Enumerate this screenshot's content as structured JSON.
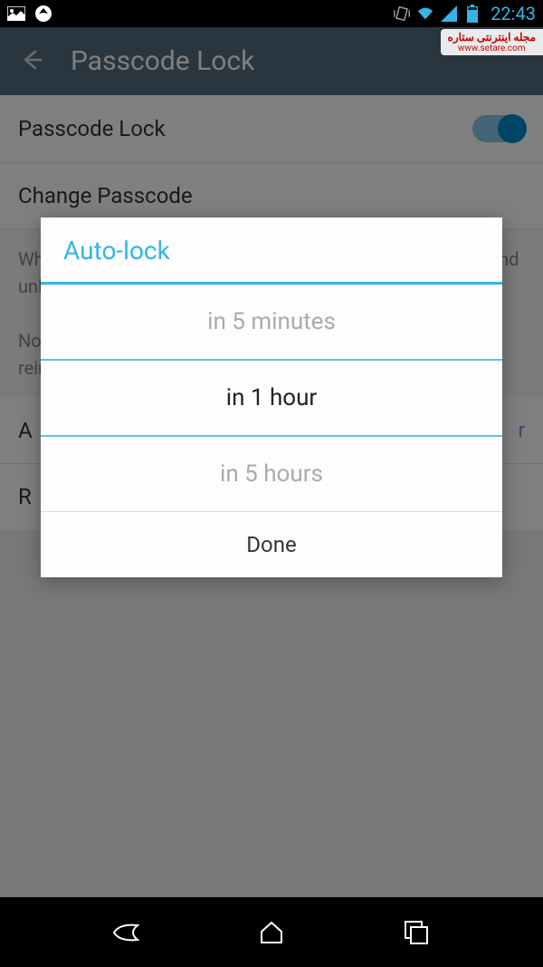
{
  "status": {
    "time": "22:43"
  },
  "header": {
    "title": "Passcode Lock"
  },
  "settings": {
    "passcode_lock": {
      "label": "Passcode Lock",
      "enabled": true
    },
    "change_passcode": {
      "label": "Change Passcode"
    },
    "desc1": "When a passcode is set, a lock icon appears...",
    "desc2": "Note: if you forget the passcode you'll need to delete and reinstall the app. All secret chats will be lost.",
    "auto_lock": {
      "label": "A",
      "value": "r"
    },
    "require_label": "R"
  },
  "dialog": {
    "title": "Auto-lock",
    "options": {
      "prev": "in 5 minutes",
      "selected": "in 1 hour",
      "next": "in 5 hours"
    },
    "done": "Done"
  },
  "watermark": {
    "line1": "مجله اینترنتی ستاره",
    "line2": "www.setare.com"
  }
}
